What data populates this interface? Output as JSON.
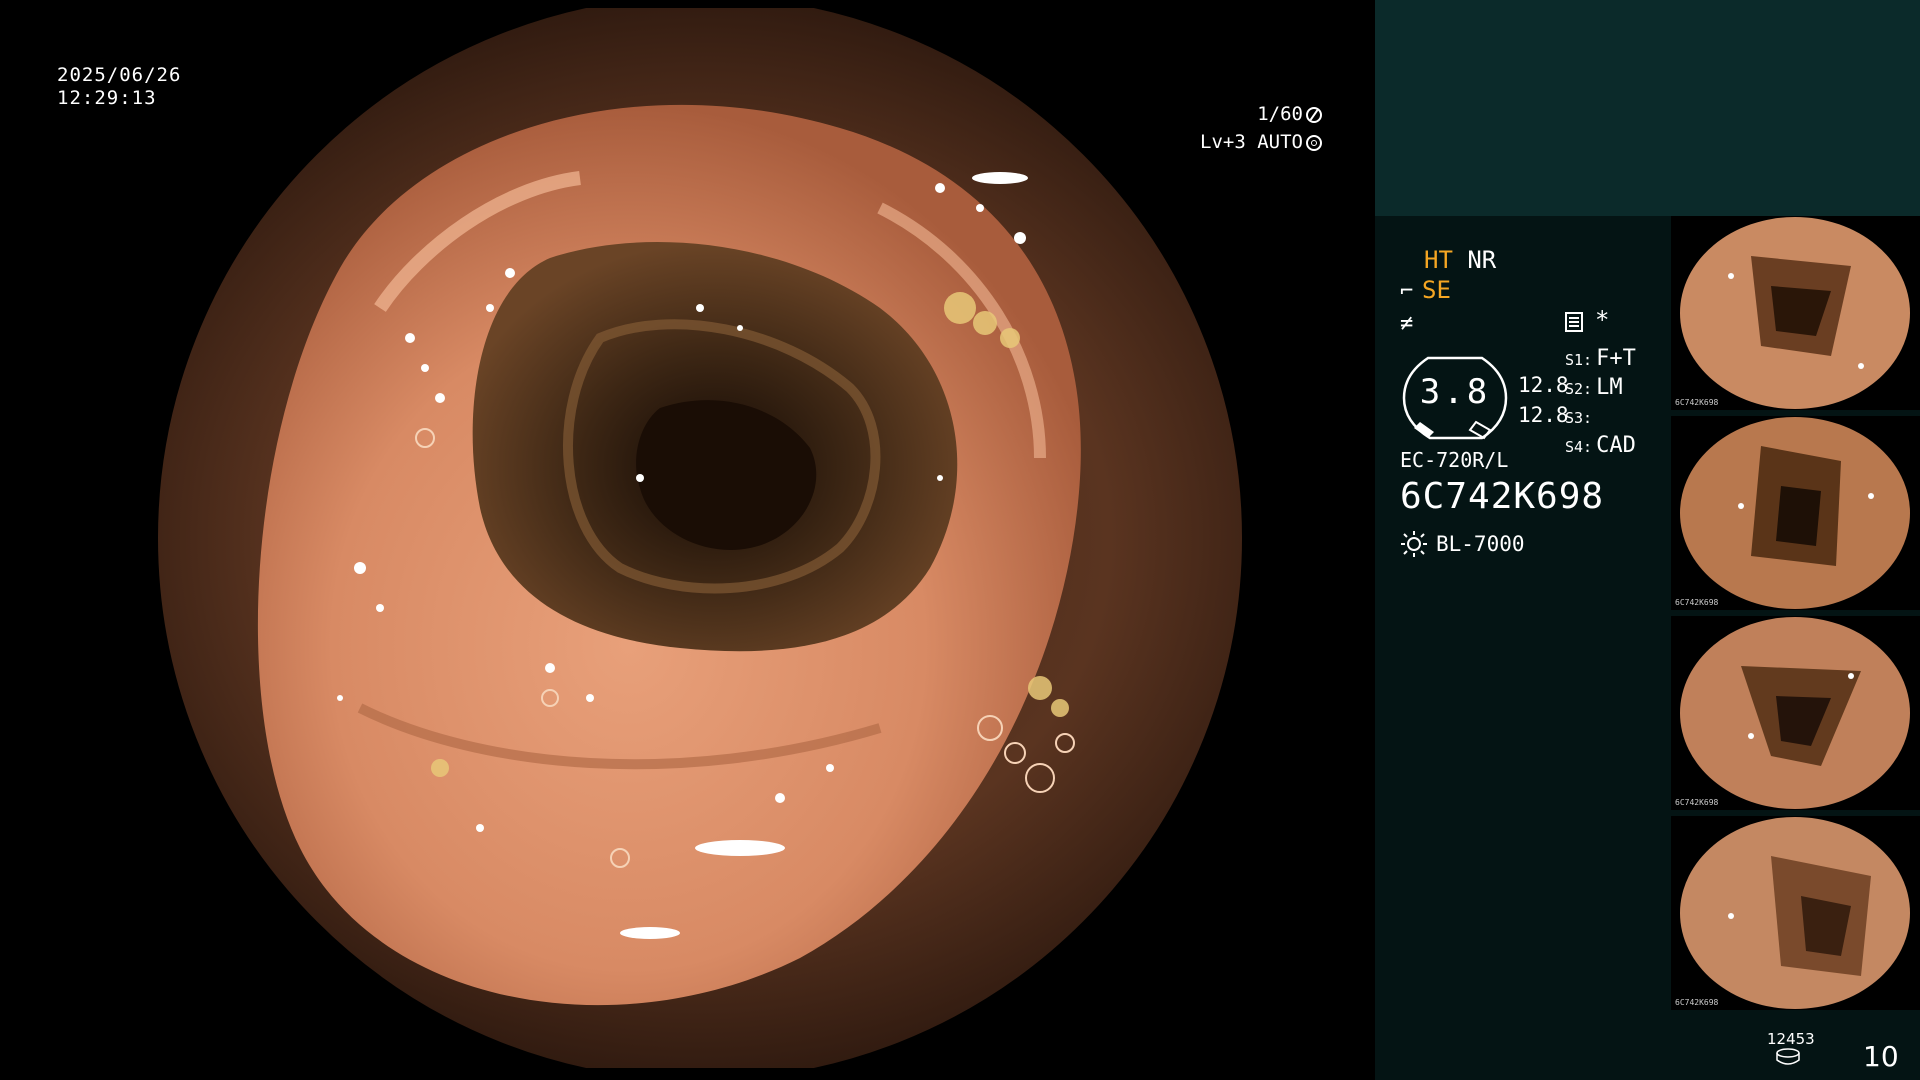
{
  "main": {
    "date": "2025/06/26",
    "time": "12:29:13",
    "shutter": "1/60",
    "level": "Lv+3 AUTO",
    "shutter_icon": "shutter-icon",
    "auto_icon": "auto-iris-icon"
  },
  "panel": {
    "ht_label": "HT",
    "nr_label": "NR",
    "se_label": "SE",
    "gauge_value": "3.8",
    "gauge_sub1": "12.8",
    "gauge_sub2": "12.8",
    "slots": [
      {
        "slot": "S1:",
        "value": "F+T"
      },
      {
        "slot": "S2:",
        "value": "LM"
      },
      {
        "slot": "S3:",
        "value": ""
      },
      {
        "slot": "S4:",
        "value": "CAD"
      }
    ],
    "asterisk": "*",
    "model": "EC-720R/L",
    "serial": "6C742K698",
    "light_source": "BL-7000",
    "thumb_caption": "6C742K698",
    "counter_small": "12453",
    "counter_big": "10"
  },
  "colors": {
    "accent": "#f5a623",
    "panel_bg": "#041414",
    "panel_top_bg": "#0b2a2a"
  }
}
